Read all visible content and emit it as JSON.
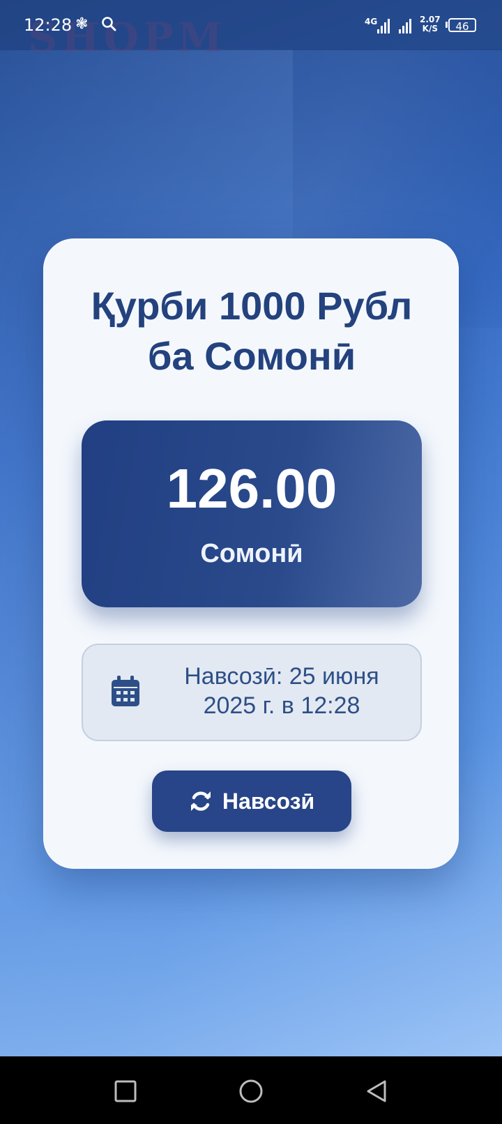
{
  "status_bar": {
    "time": "12:28",
    "network": "4G",
    "speed_value": "2.07",
    "speed_unit": "K/S",
    "battery": "46",
    "watermark": "SHOPM"
  },
  "card": {
    "title_line1": "Қурби 1000 Рубл",
    "title_line2": "ба Сомонӣ",
    "rate_value": "126.00",
    "rate_unit": "Сомонӣ",
    "updated_line1": "Навсозӣ: 25 июня",
    "updated_line2": "2025 г. в 12:28",
    "refresh_label": "Навсозӣ"
  },
  "nav": {
    "recents": "recents-square-icon",
    "home": "home-circle-icon",
    "back": "back-triangle-icon"
  },
  "colors": {
    "accent": "#274588",
    "title": "#23427e",
    "card_bg": "#f4f8fd"
  }
}
